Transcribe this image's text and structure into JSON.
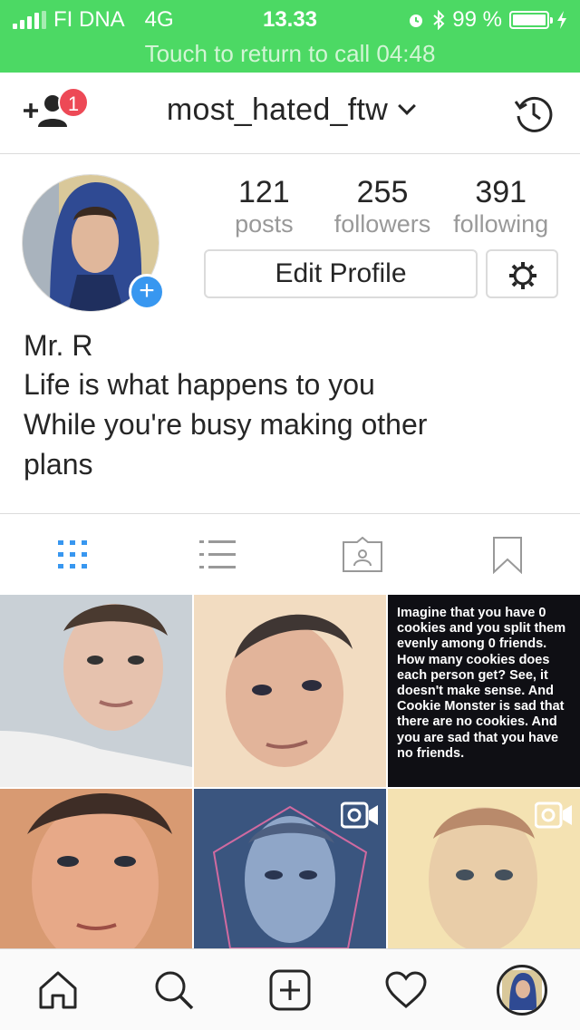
{
  "status_bar": {
    "carrier": "FI DNA",
    "network": "4G",
    "time": "13.33",
    "battery_percent": "99 %",
    "battery_level": 0.99,
    "call_banner": "Touch to return to call 04:48",
    "color": "#4cd964"
  },
  "header": {
    "username": "most_hated_ftw",
    "notification_count": "1",
    "left_icon": "add-person-icon",
    "right_icon": "history-icon"
  },
  "profile": {
    "stats": [
      {
        "value": "121",
        "label": "posts"
      },
      {
        "value": "255",
        "label": "followers"
      },
      {
        "value": "391",
        "label": "following"
      }
    ],
    "edit_label": "Edit Profile",
    "name": "Mr. R",
    "bio": [
      "Life is what happens to you",
      "While you're busy making other",
      "plans"
    ]
  },
  "tabs": [
    {
      "icon": "grid-icon",
      "active": true
    },
    {
      "icon": "list-icon",
      "active": false
    },
    {
      "icon": "tagged-icon",
      "active": false
    },
    {
      "icon": "bookmark-icon",
      "active": false
    }
  ],
  "grid_text_post": "Imagine that you have 0 cookies and you split them evenly among 0 friends. How many cookies does each person get? See, it doesn't make sense. And Cookie Monster is sad that there are no cookies. And you are sad that you have no friends.",
  "bottom_nav": [
    {
      "icon": "home-icon"
    },
    {
      "icon": "search-icon"
    },
    {
      "icon": "new-post-icon"
    },
    {
      "icon": "heart-icon"
    },
    {
      "icon": "profile-icon"
    }
  ],
  "colors": {
    "accent": "#3897f0",
    "badge": "#ed4956",
    "muted": "#999999",
    "border": "#dbdbdb"
  }
}
